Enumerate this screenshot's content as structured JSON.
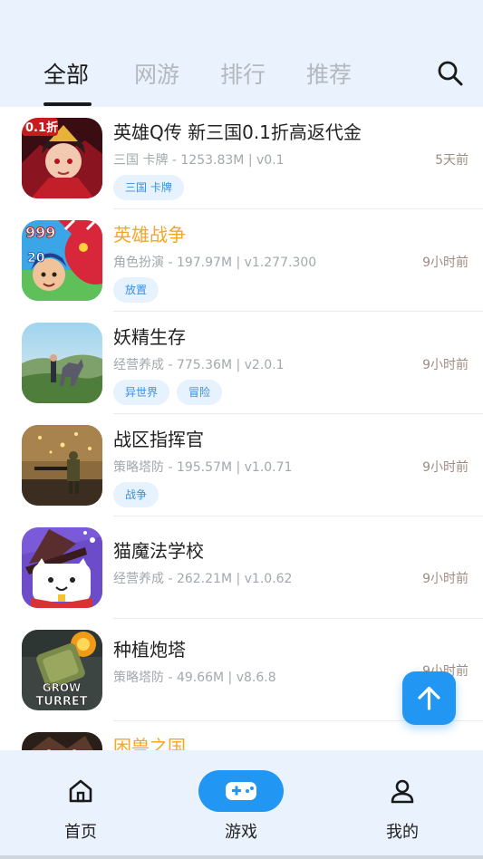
{
  "tabs": [
    {
      "label": "全部"
    },
    {
      "label": "网游"
    },
    {
      "label": "排行"
    },
    {
      "label": "推荐"
    }
  ],
  "games": [
    {
      "title": "英雄Q传 新三国0.1折高返代金",
      "highlight": false,
      "meta": "三国 卡牌 - 1253.83M | v0.1",
      "time": "5天前",
      "tags": [
        "三国 卡牌"
      ],
      "icon_text": "0.1折"
    },
    {
      "title": "英雄战争",
      "highlight": true,
      "meta": "角色扮演 - 197.97M | v1.277.300",
      "time": "9小时前",
      "tags": [
        "放置"
      ],
      "icon_text_top": "999",
      "icon_text_mid": "20"
    },
    {
      "title": "妖精生存",
      "highlight": false,
      "meta": "经营养成 - 775.36M | v2.0.1",
      "time": "9小时前",
      "tags": [
        "异世界",
        "冒险"
      ]
    },
    {
      "title": "战区指挥官",
      "highlight": false,
      "meta": "策略塔防 - 195.57M | v1.0.71",
      "time": "9小时前",
      "tags": [
        "战争"
      ]
    },
    {
      "title": "猫魔法学校",
      "highlight": false,
      "meta": "经营养成 - 262.21M | v1.0.62",
      "time": "9小时前",
      "tags": []
    },
    {
      "title": "种植炮塔",
      "highlight": false,
      "meta": "策略塔防 - 49.66M | v8.6.8",
      "time": "9小时前",
      "tags": [],
      "icon_text_top": "GROW",
      "icon_text_bottom": "TURRET"
    },
    {
      "title": "困兽之国",
      "highlight": true,
      "meta": "",
      "time": "",
      "tags": []
    }
  ],
  "nav": [
    {
      "label": "首页",
      "icon": "home-icon"
    },
    {
      "label": "游戏",
      "icon": "gamepad-icon"
    },
    {
      "label": "我的",
      "icon": "user-icon"
    }
  ],
  "colors": {
    "accent": "#2196f3",
    "highlight": "#f5a623",
    "header_bg": "#eaf3fd"
  }
}
